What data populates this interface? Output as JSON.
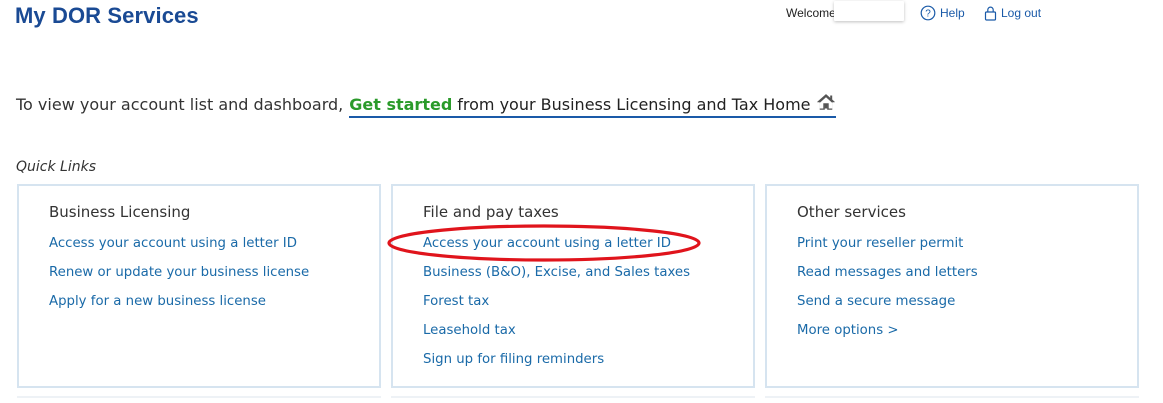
{
  "header": {
    "title": "My DOR Services",
    "welcome_label": "Welcome",
    "help_label": "Help",
    "logout_label": "Log out"
  },
  "intro": {
    "prefix": "To view your account list and dashboard,",
    "link_highlight": "Get started",
    "link_rest": "from your Business Licensing and Tax Home"
  },
  "quick_links": {
    "heading": "Quick Links",
    "cards": [
      {
        "title": "Business Licensing",
        "links": [
          "Access your account using a letter ID",
          "Renew or update your business license",
          "Apply for a new business license"
        ]
      },
      {
        "title": "File and pay taxes",
        "links": [
          "Access your account using a letter ID",
          "Business (B&O), Excise, and Sales taxes",
          "Forest tax",
          "Leasehold tax",
          "Sign up for filing reminders"
        ]
      },
      {
        "title": "Other services",
        "links": [
          "Print your reseller permit",
          "Read messages and letters",
          "Send a secure message",
          "More options >"
        ]
      }
    ]
  },
  "colors": {
    "title_blue": "#1a4a94",
    "link_blue": "#1a6aa8",
    "get_started_green": "#2a9a2a",
    "annotation_red": "#e0141c",
    "card_border": "#d6e4f0"
  },
  "icons": {
    "help": "question-circle-icon",
    "logout": "lock-icon",
    "home": "home-icon"
  }
}
